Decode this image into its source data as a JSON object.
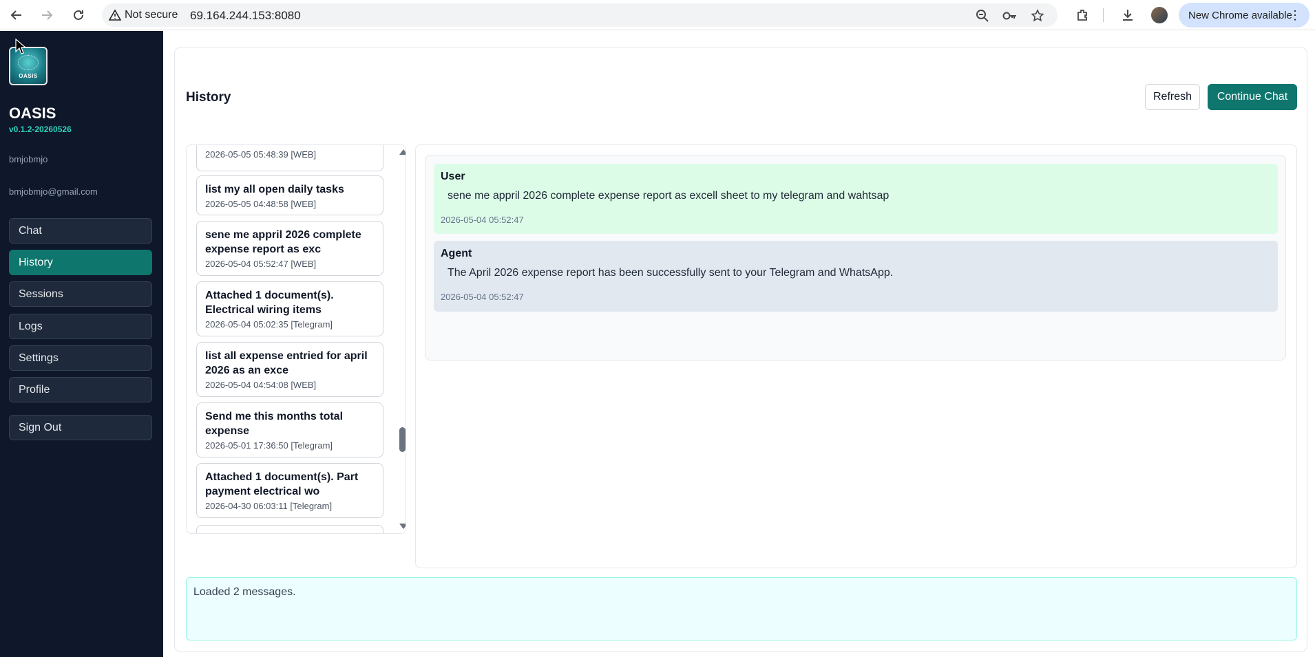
{
  "browser": {
    "security_label": "Not secure",
    "url": "69.164.244.153:8080",
    "update_label": "New Chrome available"
  },
  "sidebar": {
    "logo_text": "OASIS",
    "brand": "OASIS",
    "version": "v0.1.2-20260526",
    "username": "bmjobmjo",
    "email": "bmjobmjo@gmail.com",
    "items": [
      {
        "label": "Chat"
      },
      {
        "label": "History"
      },
      {
        "label": "Sessions"
      },
      {
        "label": "Logs"
      },
      {
        "label": "Settings"
      },
      {
        "label": "Profile"
      }
    ],
    "signout_label": "Sign Out"
  },
  "main": {
    "title": "History",
    "refresh_label": "Refresh",
    "continue_label": "Continue Chat"
  },
  "history": [
    {
      "title": "",
      "meta": "2026-05-05 05:48:39 [WEB]"
    },
    {
      "title": "list my all open daily tasks",
      "meta": "2026-05-05 04:48:58 [WEB]"
    },
    {
      "title": "sene me appril 2026 complete expense report as exc",
      "meta": "2026-05-04 05:52:47 [WEB]"
    },
    {
      "title": "Attached 1 document(s). Electrical wiring items",
      "meta": "2026-05-04 05:02:35 [Telegram]"
    },
    {
      "title": "list all expense entried for april 2026 as an exce",
      "meta": "2026-05-04 04:54:08 [WEB]"
    },
    {
      "title": "Send me this months total expense",
      "meta": "2026-05-01 17:36:50 [Telegram]"
    },
    {
      "title": "Attached 1 document(s). Part payment electrical wo",
      "meta": "2026-04-30 06:03:11 [Telegram]"
    }
  ],
  "messages": {
    "user": {
      "role": "User",
      "text": "sene me appril 2026 complete expense report as excell sheet to my telegram and wahtsap",
      "time": "2026-05-04 05:52:47"
    },
    "agent": {
      "role": "Agent",
      "text": "The April 2026 expense report has been successfully sent to your Telegram and WhatsApp.",
      "time": "2026-05-04 05:52:47"
    }
  },
  "status": {
    "text": "Loaded 2 messages."
  },
  "colors": {
    "sidebar_bg": "#0f172a",
    "accent": "#0f766e",
    "user_bubble": "#dcfce7",
    "agent_bubble": "#e2e8f0",
    "status_bg": "#ecfeff"
  }
}
